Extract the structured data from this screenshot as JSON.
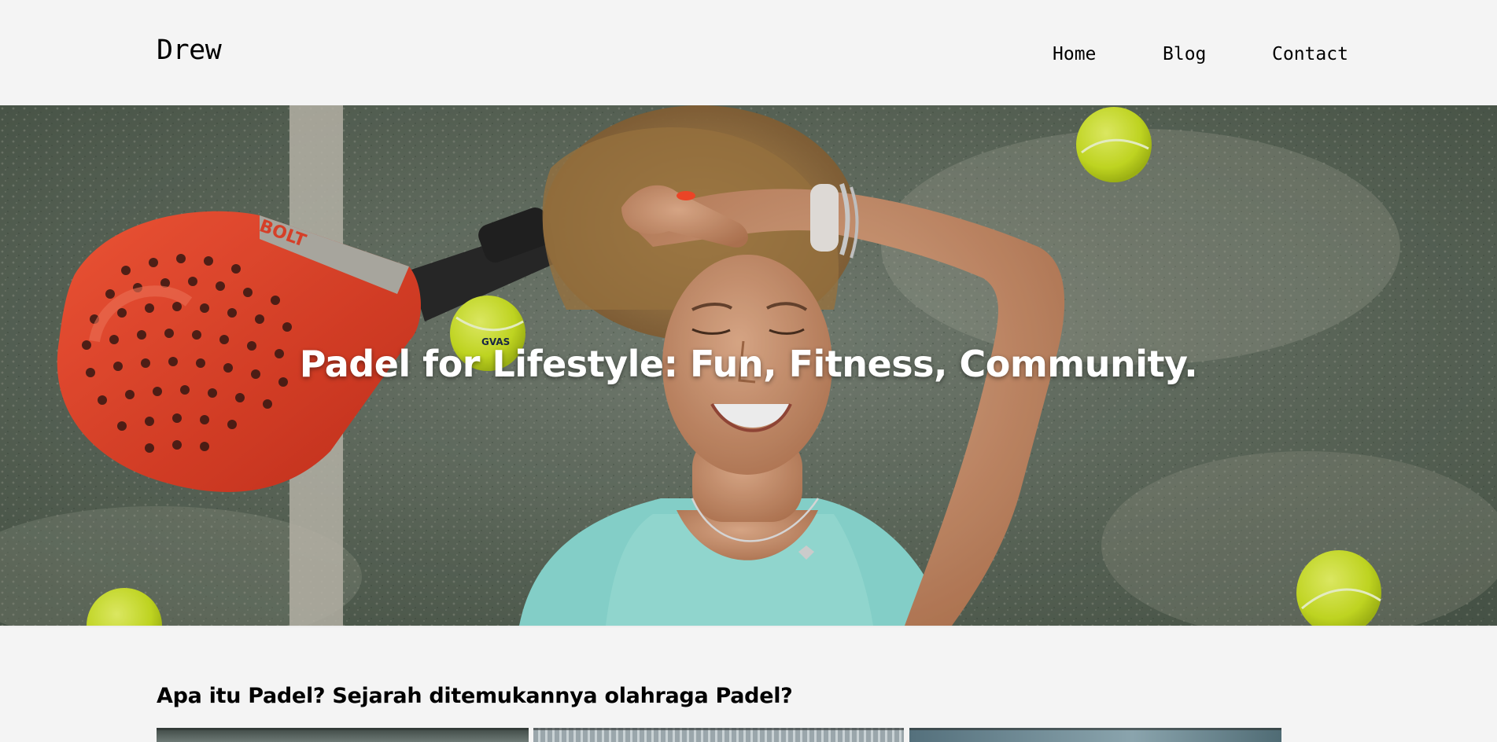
{
  "brand": {
    "name": "Drew"
  },
  "nav": {
    "home": "Home",
    "blog": "Blog",
    "contact": "Contact"
  },
  "hero": {
    "title": "Padel for Lifestyle: Fun, Fitness, Community.",
    "racket_brand": "BOLT",
    "ball_print": "GVAS"
  },
  "article": {
    "title": "Apa itu Padel? Sejarah ditemukannya olahraga Padel?"
  },
  "colors": {
    "page_bg": "#f4f4f4",
    "court_green": "#5e6a5c",
    "racket_red": "#e8452c",
    "ball_yellow": "#d9ef2a",
    "shirt_mint": "#8fe0d8"
  }
}
